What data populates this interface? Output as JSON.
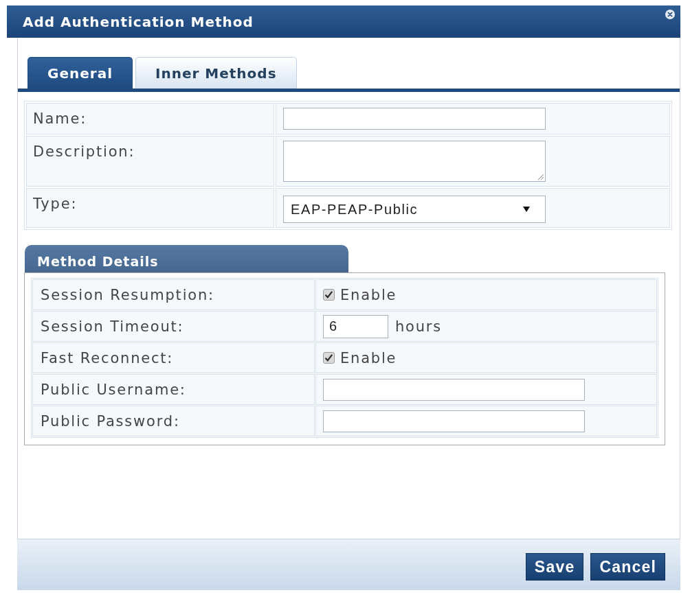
{
  "dialog": {
    "title": "Add Authentication Method"
  },
  "tabs": [
    {
      "label": "General",
      "selected": true
    },
    {
      "label": "Inner Methods",
      "selected": false
    }
  ],
  "general_fields": [
    {
      "label": "Name:",
      "kind": "text"
    },
    {
      "label": "Description:",
      "kind": "textarea"
    },
    {
      "label": "Type:",
      "kind": "select",
      "value": "EAP-PEAP-Public"
    }
  ],
  "method_details": {
    "title": "Method Details",
    "rows": [
      {
        "label": "Session Resumption:",
        "kind": "checkbox",
        "checked": true,
        "option": "Enable"
      },
      {
        "label": "Session Timeout:",
        "kind": "number",
        "value": "6",
        "unit": "hours"
      },
      {
        "label": "Fast Reconnect:",
        "kind": "checkbox",
        "checked": true,
        "option": "Enable"
      },
      {
        "label": "Public Username:",
        "kind": "text"
      },
      {
        "label": "Public Password:",
        "kind": "text"
      }
    ]
  },
  "buttons": [
    "Save",
    "Cancel"
  ]
}
